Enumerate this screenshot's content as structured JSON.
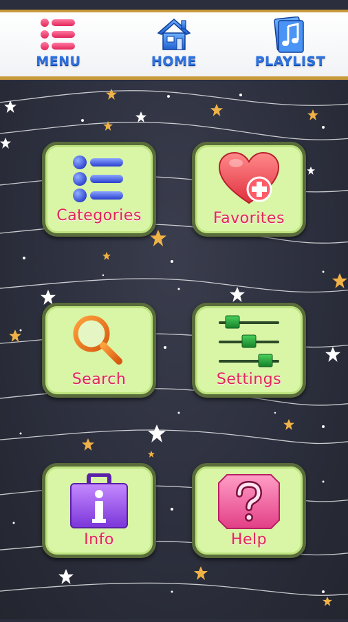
{
  "nav": {
    "menu_label": "MENU",
    "home_label": "HOME",
    "playlist_label": "PLAYLIST"
  },
  "tiles": {
    "categories": "Categories",
    "favorites": "Favorites",
    "search": "Search",
    "settings": "Settings",
    "info": "Info",
    "help": "Help"
  },
  "colors": {
    "nav_text": "#2f73e0",
    "tile_fill": "#d9f5a6",
    "tile_border": "#596c3a",
    "tile_text": "#e2265a",
    "bar_border": "#c89a3c",
    "background": "#2b2e3c"
  }
}
